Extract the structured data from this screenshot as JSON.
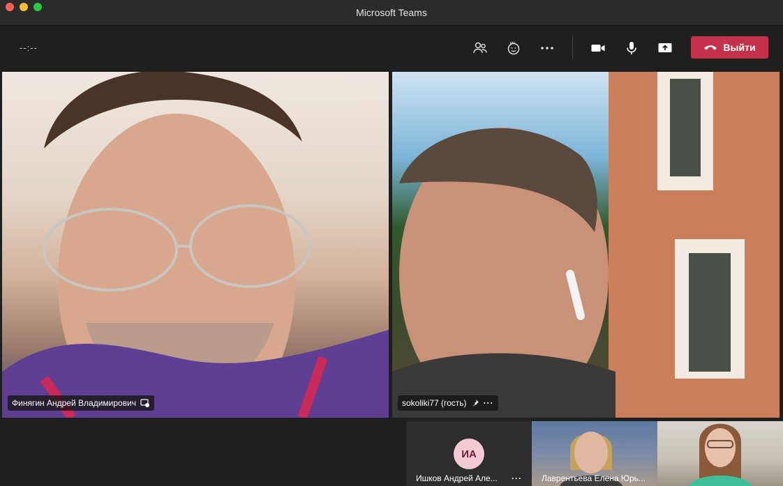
{
  "window": {
    "title": "Microsoft Teams"
  },
  "toolbar": {
    "timer": "--:--",
    "icons": [
      "people-icon",
      "raise-hand-icon",
      "more-icon",
      "camera-icon",
      "mic-icon",
      "share-screen-icon"
    ],
    "leave_label": "Выйти",
    "leave_color": "#c4314b"
  },
  "participants": [
    {
      "name": "Финягин Андрей Владимирович",
      "badge_icon": "share-content-icon"
    },
    {
      "name": "sokoliki77 (гость)",
      "badge_icon": "pin-icon",
      "more": "···"
    }
  ],
  "thumbnails": [
    {
      "initials": "ИА",
      "name": "Ишков Андрей Але...",
      "more": "···"
    },
    {
      "name": "Лаврентьева Елена Юрь..."
    },
    {
      "name": ""
    }
  ]
}
